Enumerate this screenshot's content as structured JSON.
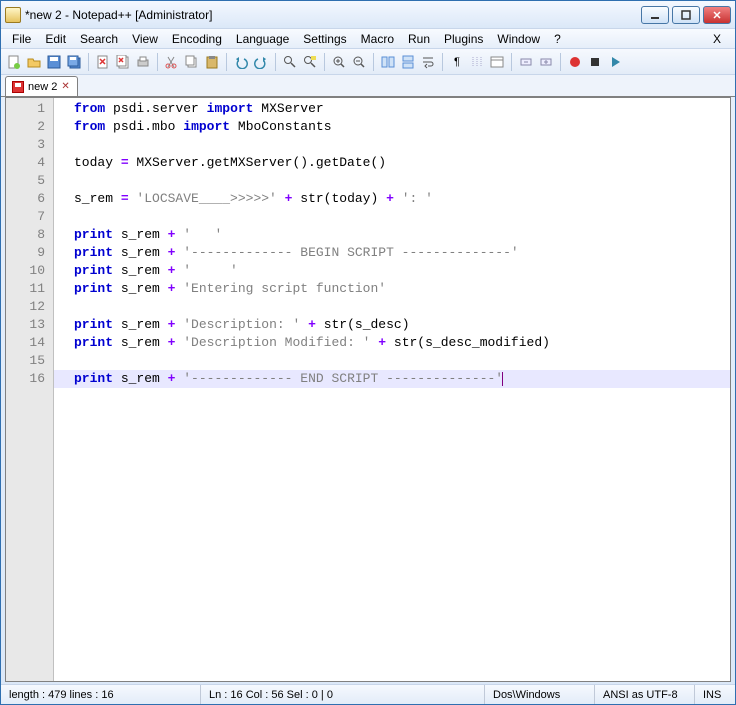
{
  "window": {
    "title": "*new  2 - Notepad++ [Administrator]"
  },
  "menu": {
    "file": "File",
    "edit": "Edit",
    "search": "Search",
    "view": "View",
    "encoding": "Encoding",
    "language": "Language",
    "settings": "Settings",
    "macro": "Macro",
    "run": "Run",
    "plugins": "Plugins",
    "window": "Window",
    "help": "?",
    "close_x": "X"
  },
  "tab": {
    "name": "new  2",
    "close": "✕"
  },
  "status": {
    "length": "length : 479    lines : 16",
    "pos": "Ln : 16    Col : 56    Sel : 0 | 0",
    "eol": "Dos\\Windows",
    "enc": "ANSI as UTF-8",
    "mode": "INS"
  },
  "code": {
    "lines": [
      {
        "n": "1",
        "kind": "import1"
      },
      {
        "n": "2",
        "kind": "import2"
      },
      {
        "n": "3",
        "kind": "blank"
      },
      {
        "n": "4",
        "kind": "today"
      },
      {
        "n": "5",
        "kind": "blank"
      },
      {
        "n": "6",
        "kind": "srem"
      },
      {
        "n": "7",
        "kind": "blank"
      },
      {
        "n": "8",
        "kind": "p1"
      },
      {
        "n": "9",
        "kind": "p2"
      },
      {
        "n": "10",
        "kind": "p3"
      },
      {
        "n": "11",
        "kind": "p4"
      },
      {
        "n": "12",
        "kind": "blank"
      },
      {
        "n": "13",
        "kind": "p5"
      },
      {
        "n": "14",
        "kind": "p6"
      },
      {
        "n": "15",
        "kind": "blank"
      },
      {
        "n": "16",
        "kind": "p7",
        "current": true
      }
    ],
    "tokens": {
      "from": "from",
      "import": "import",
      "print": "print",
      "psdi_server": "psdi.server",
      "psdi_mbo": "psdi.mbo",
      "MXServer": "MXServer",
      "MboConstants": "MboConstants",
      "today": "today",
      "eq": " = ",
      "getMX": "MXServer.getMXServer().getDate()",
      "s_rem": "s_rem",
      "locsave": "'LOCSAVE____>>>>>'",
      "plus": " + ",
      "str_today": "str(today)",
      "colon_str": "': '",
      "empty1": "'   '",
      "begin": "'------------- BEGIN SCRIPT --------------'",
      "empty2": "'     '",
      "entering": "'Entering script function'",
      "desc_lbl": "'Description: '",
      "str_desc": "str(s_desc)",
      "descmod_lbl": "'Description Modified: '",
      "str_descmod": "str(s_desc_modified)",
      "end": "'------------- END SCRIPT --------------'"
    }
  }
}
